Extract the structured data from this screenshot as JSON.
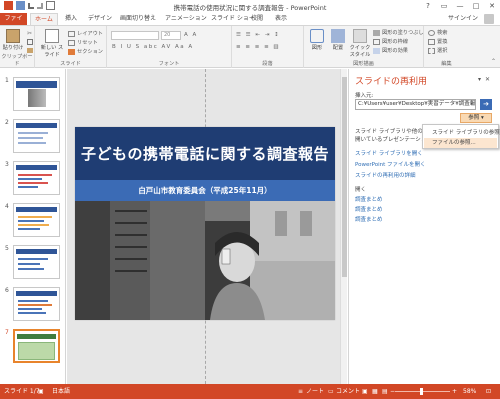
{
  "window": {
    "title": "携帯電話の使用状況に関する調査報告 - PowerPoint",
    "controls": [
      "?",
      "▭",
      "—",
      "□",
      "✕"
    ]
  },
  "tabs": {
    "file": "ファイル",
    "home": "ホーム",
    "insert": "挿入",
    "design": "デザイン",
    "transitions": "画面切り替え",
    "animations": "アニメーション",
    "slideshow": "スライド ショー",
    "review": "校閲",
    "view": "表示",
    "signin": "サインイン"
  },
  "ribbon": {
    "clipboard": {
      "paste": "貼り付け",
      "label": "クリップボード"
    },
    "slides": {
      "new_slide": "新しい スライド",
      "layout": "レイアウト",
      "reset": "リセット",
      "section": "セクション",
      "label": "スライド"
    },
    "font": {
      "size_value": "20",
      "label": "フォント"
    },
    "paragraph": {
      "label": "段落"
    },
    "drawing": {
      "shapes": "図形",
      "arrange": "配置",
      "quick_styles": "クイック スタイル",
      "fill": "図形の塗りつぶし",
      "outline": "図形の枠線",
      "effects": "図形の効果",
      "label": "図形描画"
    },
    "editing": {
      "find": "検索",
      "replace": "置換",
      "select": "選択",
      "label": "編集"
    }
  },
  "thumbnails": {
    "numbers": [
      "1",
      "2",
      "3",
      "4",
      "5",
      "6",
      "7"
    ],
    "selected": "7"
  },
  "slide": {
    "title": "子どもの携帯電話に関する調査報告",
    "subtitle": "白戸山市教育委員会（平成25年11月）"
  },
  "taskpane": {
    "title": "スライドの再利用",
    "source_label": "挿入元:",
    "source_value": "C:¥Users¥user¥Desktop¥実習データ¥調査報",
    "browse_button": "参照",
    "browse_menu": [
      "スライド ライブラリの参照...",
      "ファイルの参照..."
    ],
    "info_line1": "スライド ライブラリや他の PowerPoint",
    "info_line2": "開いているプレゼンテーション",
    "open_library": "スライド ライブラリを開く",
    "open_file": "PowerPoint ファイルを開く",
    "learn_more": "スライドの再利用の詳細",
    "recent_label": "開く",
    "recent_items": [
      "調査まとめ",
      "調査まとめ",
      "調査まとめ"
    ]
  },
  "status": {
    "slide_position": "スライド 1/7",
    "language": "日本語",
    "notes": "ノート",
    "comments": "コメント",
    "zoom": "58%"
  },
  "colors": {
    "accent": "#d24726",
    "slide_title_bg": "#1f3d73",
    "slide_subtitle_bg": "#3b6bb5",
    "link": "#2e6db4"
  }
}
